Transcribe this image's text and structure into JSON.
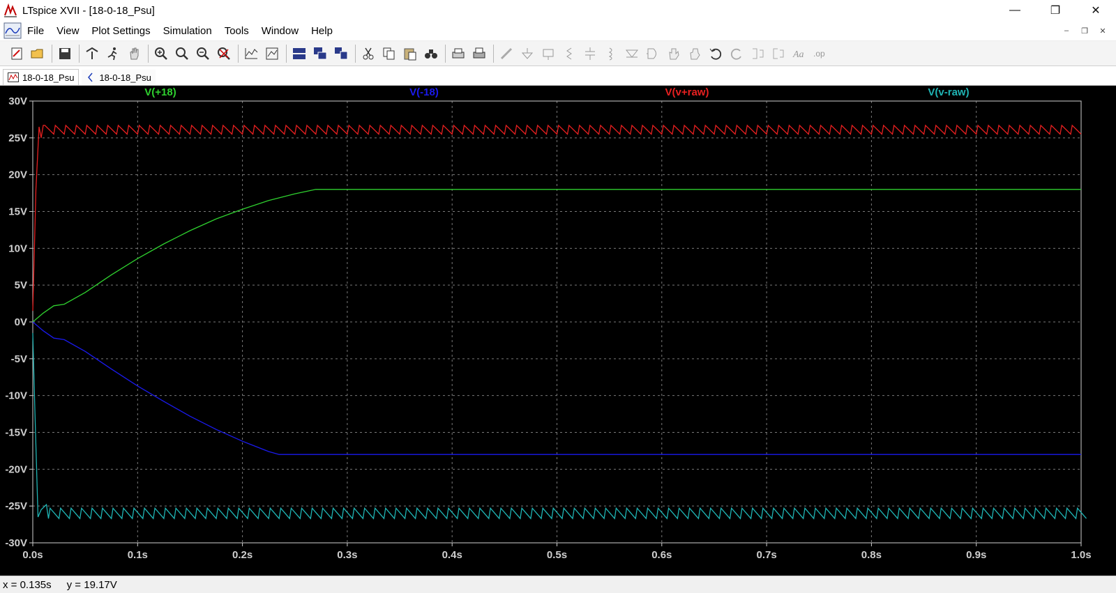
{
  "window": {
    "title": "LTspice XVII - [18-0-18_Psu]"
  },
  "menu": {
    "items": [
      {
        "label": "File"
      },
      {
        "label": "View"
      },
      {
        "label": "Plot Settings"
      },
      {
        "label": "Simulation"
      },
      {
        "label": "Tools"
      },
      {
        "label": "Window"
      },
      {
        "label": "Help"
      }
    ]
  },
  "tabs": [
    {
      "label": "18-0-18_Psu",
      "icon": "waveform-icon",
      "active": true
    },
    {
      "label": "18-0-18_Psu",
      "icon": "schematic-icon",
      "active": false
    }
  ],
  "toolbar": {
    "icons": [
      "new-schematic-icon",
      "open-icon",
      "save-icon",
      "control-panel-icon",
      "run-icon",
      "halt-icon",
      "zoom-in-icon",
      "zoom-fit-icon",
      "zoom-out-icon",
      "zoom-cancel-icon",
      "autorange-icon",
      "manual-limits-icon",
      "tile-horizontal-icon",
      "cascade-icon",
      "tile-vertical-icon",
      "cut-icon",
      "copy-icon",
      "paste-icon",
      "find-icon",
      "print-icon",
      "print-setup-icon",
      "wire-icon",
      "ground-icon",
      "label-icon",
      "resistor-icon",
      "capacitor-icon",
      "inductor-icon",
      "diode-icon",
      "component-icon",
      "move-icon",
      "drag-icon",
      "undo-icon",
      "redo-icon",
      "rotate-icon",
      "mirror-icon",
      "text-icon",
      "spice-directive-icon"
    ]
  },
  "chart_data": {
    "type": "line",
    "title": "",
    "xlabel": "",
    "ylabel": "",
    "xlim": [
      0,
      1.0
    ],
    "ylim": [
      -30,
      30
    ],
    "x_ticks": [
      "0.0s",
      "0.1s",
      "0.2s",
      "0.3s",
      "0.4s",
      "0.5s",
      "0.6s",
      "0.7s",
      "0.8s",
      "0.9s",
      "1.0s"
    ],
    "y_ticks": [
      "30V",
      "25V",
      "20V",
      "15V",
      "10V",
      "5V",
      "0V",
      "-5V",
      "-10V",
      "-15V",
      "-20V",
      "-25V",
      "-30V"
    ],
    "grid": true,
    "background": "#000000",
    "legend_position": "top",
    "series": [
      {
        "name": "V(+18)",
        "color": "#2fd12f",
        "x": [
          0,
          0.01,
          0.02,
          0.03,
          0.05,
          0.075,
          0.1,
          0.125,
          0.15,
          0.175,
          0.2,
          0.225,
          0.25,
          0.27,
          1.0
        ],
        "y": [
          0,
          1.2,
          2.2,
          2.4,
          4.0,
          6.4,
          8.6,
          10.6,
          12.4,
          14.0,
          15.3,
          16.5,
          17.4,
          18.0,
          18.0
        ]
      },
      {
        "name": "V(-18)",
        "color": "#1a1aee",
        "x": [
          0,
          0.01,
          0.02,
          0.03,
          0.05,
          0.075,
          0.1,
          0.125,
          0.15,
          0.175,
          0.2,
          0.225,
          0.235,
          1.0
        ],
        "y": [
          0,
          -1.2,
          -2.2,
          -2.4,
          -4.0,
          -6.4,
          -8.7,
          -10.8,
          -12.8,
          -14.6,
          -16.2,
          -17.6,
          -18.0,
          -18.0
        ]
      },
      {
        "name": "V(v+raw)",
        "color": "#e82020",
        "ripple": {
          "start": 0.01,
          "end": 1.0,
          "period": 0.01,
          "high": 26.7,
          "low": 25.5
        },
        "startup": {
          "x": [
            0,
            0.003,
            0.006,
            0.008,
            0.01
          ],
          "y": [
            1.5,
            18.0,
            26.5,
            25.0,
            26.7
          ]
        }
      },
      {
        "name": "V(v-raw)",
        "color": "#1fb4b4",
        "ripple": {
          "start": 0.015,
          "end": 1.0,
          "period": 0.01,
          "high": -25.3,
          "low": -26.7
        },
        "startup": {
          "x": [
            0,
            0.002,
            0.005,
            0.008,
            0.013,
            0.015
          ],
          "y": [
            -1.5,
            -12.0,
            -26.5,
            -25.5,
            -24.8,
            -26.7
          ]
        }
      }
    ]
  },
  "status": {
    "x_readout": "x = 0.135s",
    "y_readout": "y = 19.17V"
  }
}
